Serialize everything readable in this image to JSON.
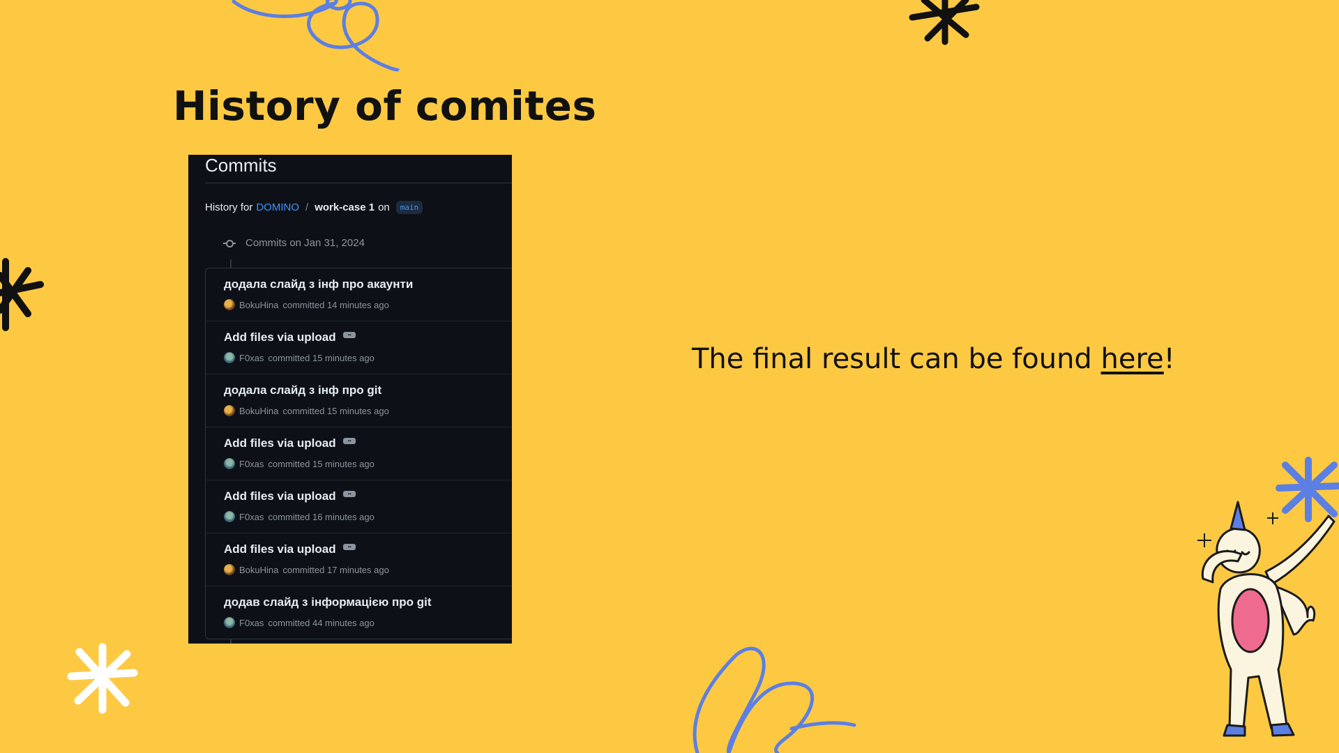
{
  "slide": {
    "title": "History of comites",
    "result_text": "The final result can be found ",
    "result_link": "here",
    "result_suffix": "!"
  },
  "screenshot": {
    "heading": "Commits",
    "history_prefix": "History for",
    "repo_owner": "DOMINO",
    "repo_sep": "/",
    "repo_name": "work-case 1",
    "on_label": "on",
    "branch": "main",
    "date_header": "Commits on Jan 31, 2024",
    "commits": [
      {
        "message": "додала слайд з інф про акаунти",
        "author": "BokuHina",
        "time": "committed 14 minutes ago",
        "has_ellipsis": false
      },
      {
        "message": "Add files via upload",
        "author": "F0xas",
        "time": "committed 15 minutes ago",
        "has_ellipsis": true
      },
      {
        "message": "додала слайд з інф про git",
        "author": "BokuHina",
        "time": "committed 15 minutes ago",
        "has_ellipsis": false
      },
      {
        "message": "Add files via upload",
        "author": "F0xas",
        "time": "committed 15 minutes ago",
        "has_ellipsis": true
      },
      {
        "message": "Add files via upload",
        "author": "F0xas",
        "time": "committed 16 minutes ago",
        "has_ellipsis": true
      },
      {
        "message": "Add files via upload",
        "author": "BokuHina",
        "time": "committed 17 minutes ago",
        "has_ellipsis": true
      },
      {
        "message": "додав слайд з інформацією про git",
        "author": "F0xas",
        "time": "committed 44 minutes ago",
        "has_ellipsis": false
      }
    ]
  },
  "colors": {
    "background": "#FDC943",
    "panel": "#0D1117",
    "link_blue": "#4493F8",
    "scribble_blue": "#5B7FE3",
    "unicorn_belly": "#EE6A8E"
  },
  "icons": [
    "commit-icon",
    "ellipsis-icon",
    "avatar",
    "asterisk-doodle",
    "scribble-doodle",
    "unicorn-illustration"
  ]
}
